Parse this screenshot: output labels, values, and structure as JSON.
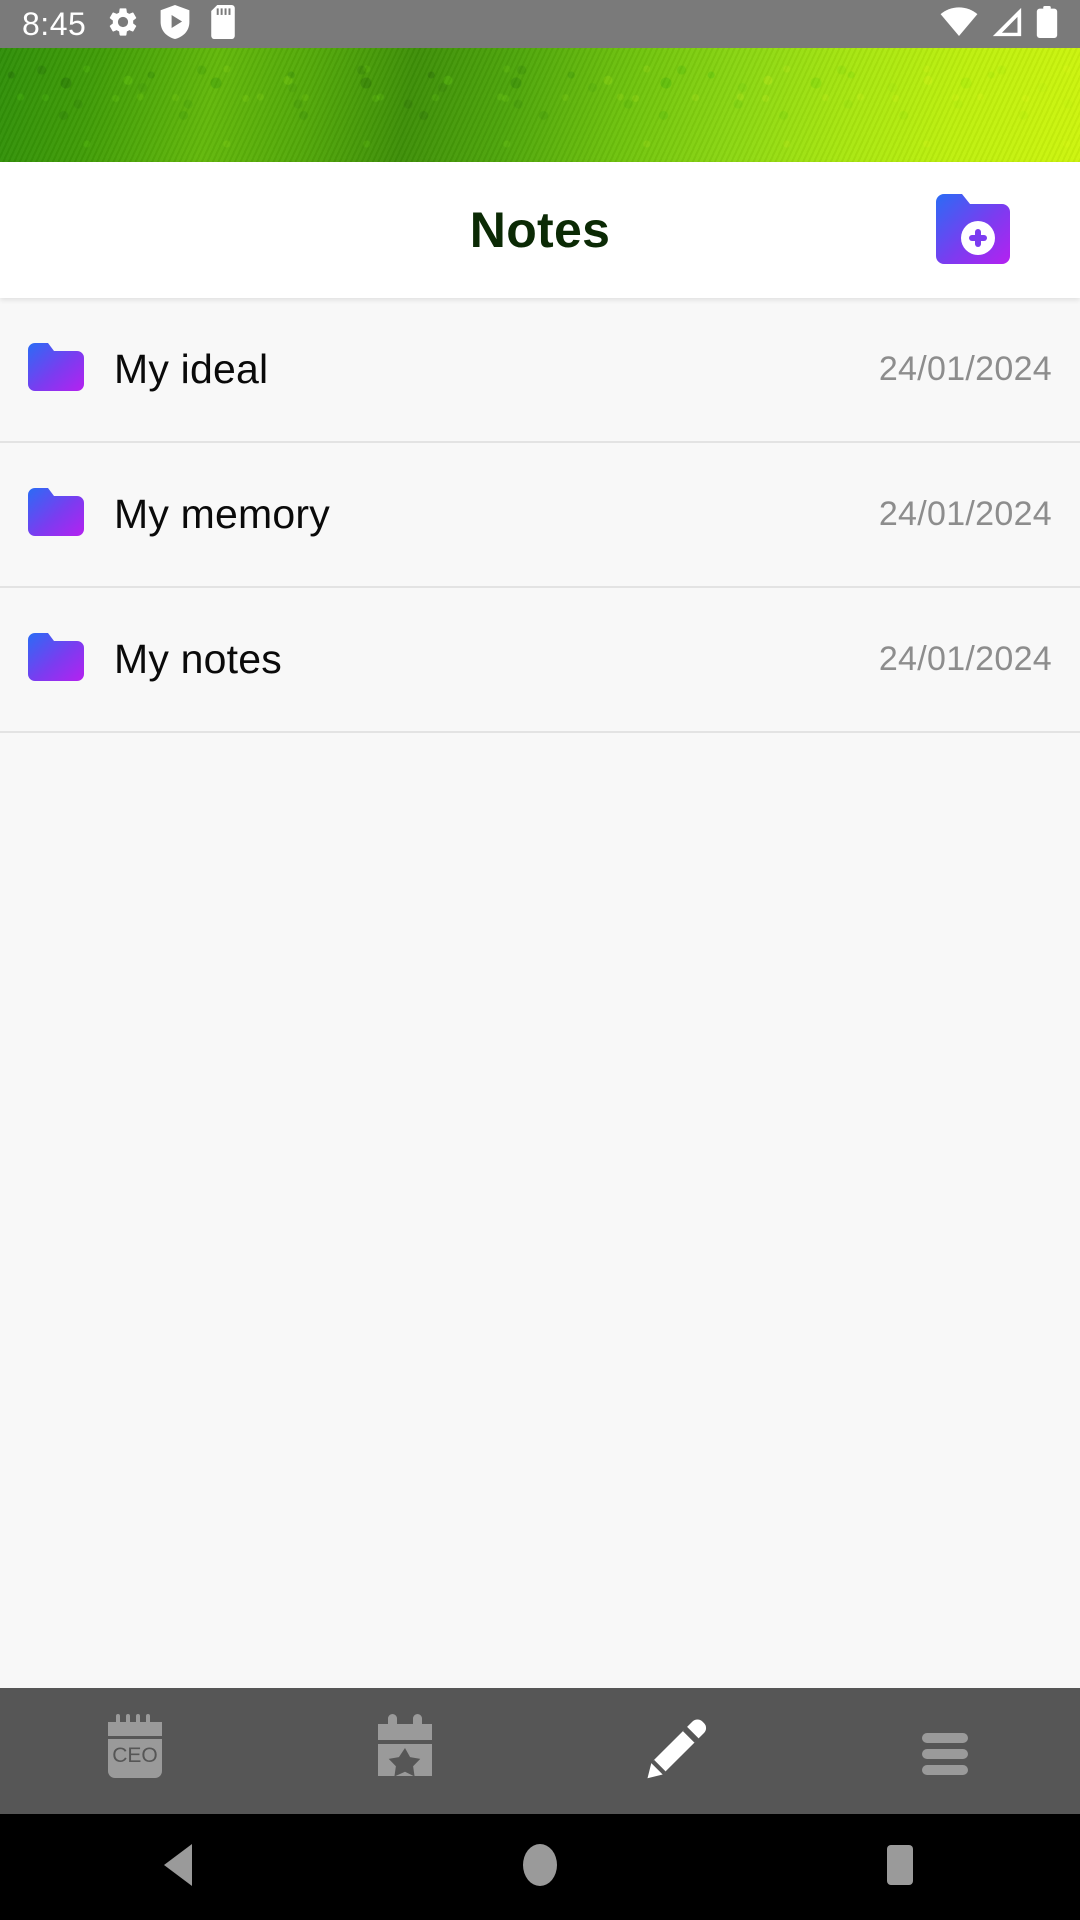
{
  "status_bar": {
    "time": "8:45",
    "left_icons": [
      "gear-icon",
      "play-protect-icon",
      "sd-card-icon"
    ],
    "right_icons": [
      "wifi-icon",
      "cellular-signal-icon",
      "battery-icon"
    ],
    "background_color": "#7a7a7a",
    "foreground_color": "#ffffff"
  },
  "banner": {
    "name": "green-texture-banner",
    "gradient_start": "#2f8f08",
    "gradient_end": "#cdf50c"
  },
  "header": {
    "title": "Notes",
    "title_color": "#0b2a05",
    "add_folder_button": {
      "name": "add-folder-button",
      "icon": "folder-plus-icon",
      "gradient_start": "#2a6cf5",
      "gradient_end": "#b521f0",
      "plus_color": "#7b3cf0"
    }
  },
  "list": {
    "background_color": "#f8f8f8",
    "divider_color": "#e3e3e3",
    "folder_icon": {
      "name": "folder-icon",
      "gradient_start": "#2a6cf5",
      "gradient_end": "#b521f0"
    },
    "items": [
      {
        "title": "My ideal",
        "date": "24/01/2024"
      },
      {
        "title": "My memory",
        "date": "24/01/2024"
      },
      {
        "title": "My notes",
        "date": "24/01/2024"
      }
    ]
  },
  "tab_bar": {
    "background_color": "#565656",
    "inactive_color": "#9a9a9a",
    "active_color": "#ffffff",
    "tabs": [
      {
        "name": "tab-notepad",
        "icon": "notepad-ceo-icon",
        "label": "CEO",
        "active": false
      },
      {
        "name": "tab-calendar",
        "icon": "calendar-star-icon",
        "label": "",
        "active": false
      },
      {
        "name": "tab-edit",
        "icon": "pencil-icon",
        "label": "",
        "active": true
      },
      {
        "name": "tab-menu",
        "icon": "hamburger-menu-icon",
        "label": "",
        "active": false
      }
    ]
  },
  "android_nav": {
    "background_color": "#000000",
    "icon_color": "#9a9a9a",
    "buttons": [
      {
        "name": "nav-back-button",
        "icon": "back-triangle-icon"
      },
      {
        "name": "nav-home-button",
        "icon": "home-circle-icon"
      },
      {
        "name": "nav-recents-button",
        "icon": "recents-square-icon"
      }
    ]
  }
}
